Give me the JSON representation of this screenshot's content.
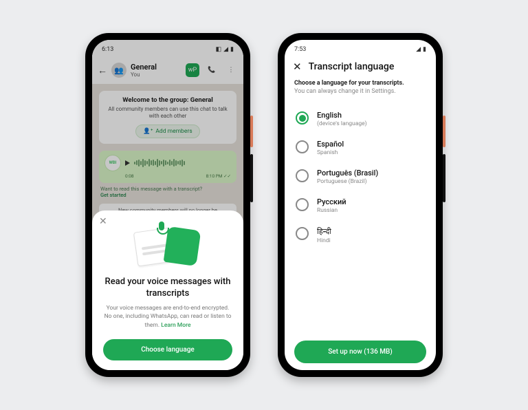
{
  "left": {
    "status_time": "6:13",
    "chat": {
      "title": "General",
      "subtitle": "You",
      "back_icon": "back",
      "video_icon": "video",
      "call_icon": "call",
      "more_icon": "more"
    },
    "welcome": {
      "title": "Welcome to the group: General",
      "desc": "All community members can use this chat to talk with each other",
      "add_members": "Add members"
    },
    "voice": {
      "sender_initials": "WBI",
      "duration": "0:08",
      "time": "8:10 PM",
      "hint_text": "Want to read this message with a transcript?",
      "hint_link": "Get started"
    },
    "system_msg": "New community members will no longer be",
    "sheet": {
      "title": "Read your voice messages with transcripts",
      "desc": "Your voice messages are end-to-end encrypted. No one, including WhatsApp, can read or listen to them.",
      "learn_more": "Learn More",
      "cta": "Choose language"
    }
  },
  "right": {
    "status_time": "7:53",
    "header": "Transcript language",
    "sub1": "Choose a language for your transcripts.",
    "sub2": "You can always change it in Settings.",
    "languages": [
      {
        "name": "English",
        "sub": "(device's language)",
        "selected": true
      },
      {
        "name": "Español",
        "sub": "Spanish",
        "selected": false
      },
      {
        "name": "Português (Brasil)",
        "sub": "Portuguese (Brazil)",
        "selected": false
      },
      {
        "name": "Русский",
        "sub": "Russian",
        "selected": false
      },
      {
        "name": "हिन्दी",
        "sub": "Hindi",
        "selected": false
      }
    ],
    "cta": "Set up now (136 MB)"
  }
}
